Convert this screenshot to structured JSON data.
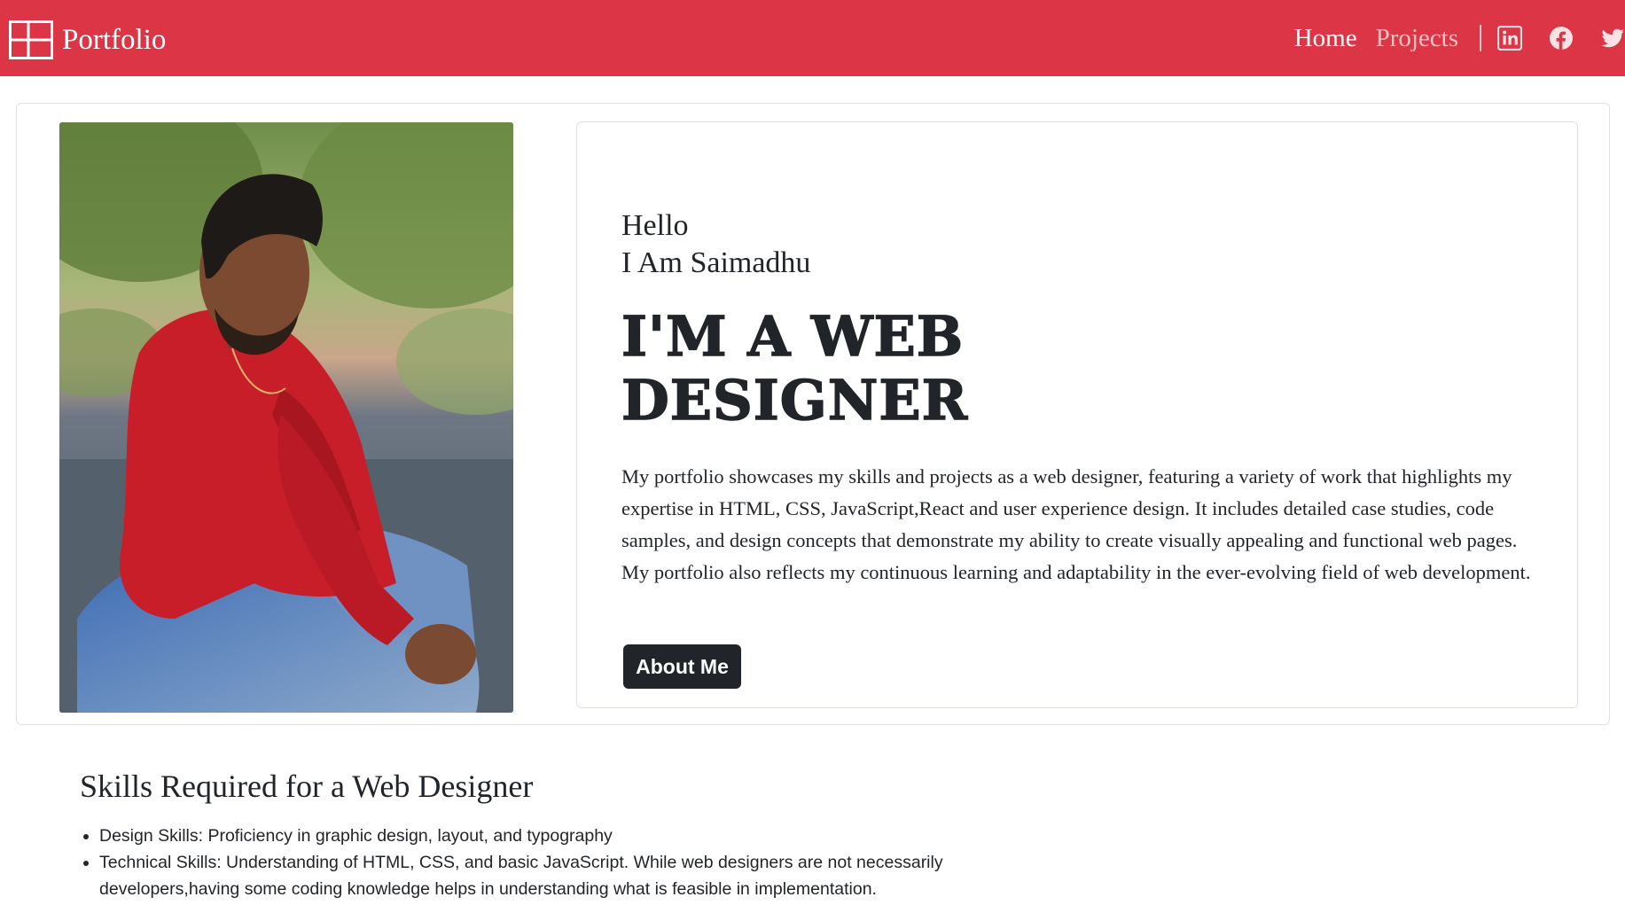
{
  "navbar": {
    "brand": "Portfolio",
    "brand_icon": "layout-grid-icon",
    "links": [
      "Home",
      "Projects"
    ],
    "social_icons": [
      "linkedin-icon",
      "facebook-icon",
      "twitter-icon"
    ],
    "background_color": "#dc3545"
  },
  "hero": {
    "photo": "person-photo",
    "greeting_line1": "Hello",
    "greeting_line2": "I Am Saimadhu",
    "headline_line1": "I'M A WEB",
    "headline_line2": "DESIGNER",
    "description": "My portfolio showcases my skills and projects as a web designer, featuring a variety of work that highlights my expertise in HTML, CSS, JavaScript,React and user experience design. It includes detailed case studies, code samples, and design concepts that demonstrate my ability to create visually appealing and functional web pages. My portfolio also reflects my continuous learning and adaptability in the ever-evolving field of web development.",
    "button_label": "About Me"
  },
  "skills": {
    "title": "Skills Required for a Web Designer",
    "items": [
      "Design Skills: Proficiency in graphic design, layout, and typography",
      "Technical Skills: Understanding of HTML, CSS, and basic JavaScript. While web designers are not necessarily developers,having some coding knowledge helps in understanding what is feasible in implementation."
    ]
  }
}
